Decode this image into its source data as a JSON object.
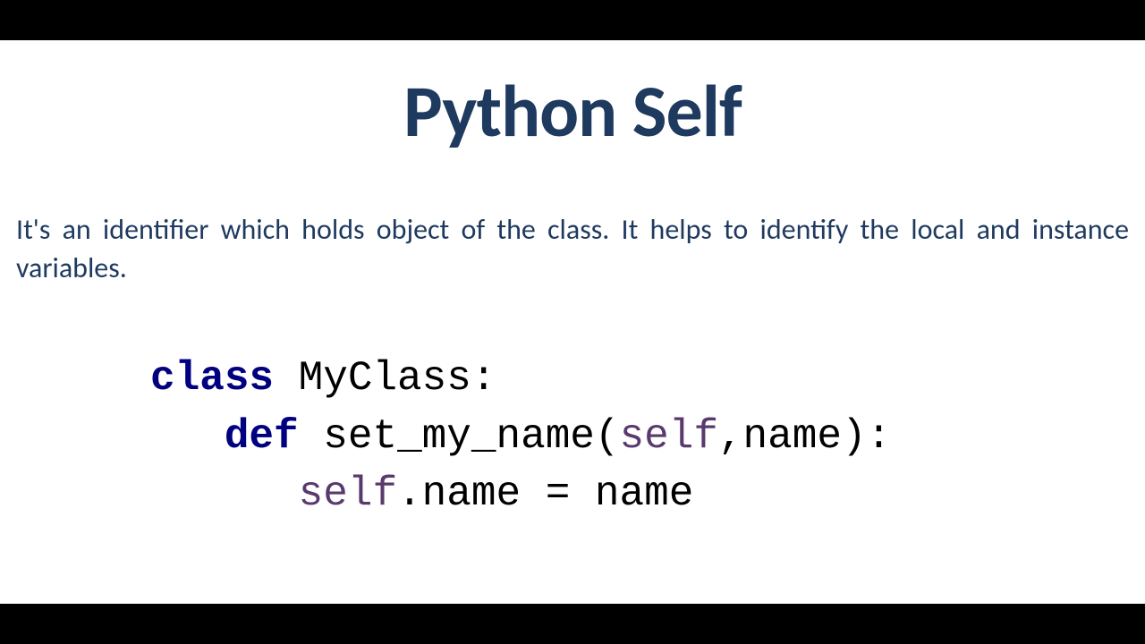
{
  "title": "Python Self",
  "description": "It's an identifier which holds object of the class. It helps to identify the local and instance variables.",
  "code": {
    "line1": {
      "keyword": "class",
      "rest": " MyClass:"
    },
    "line2": {
      "indent": "   ",
      "keyword": "def",
      "method_name": " set_my_name(",
      "self_param": "self",
      "params_rest": ",name):"
    },
    "line3": {
      "indent": "      ",
      "self_ref": "self",
      "rest": ".name = name"
    }
  }
}
